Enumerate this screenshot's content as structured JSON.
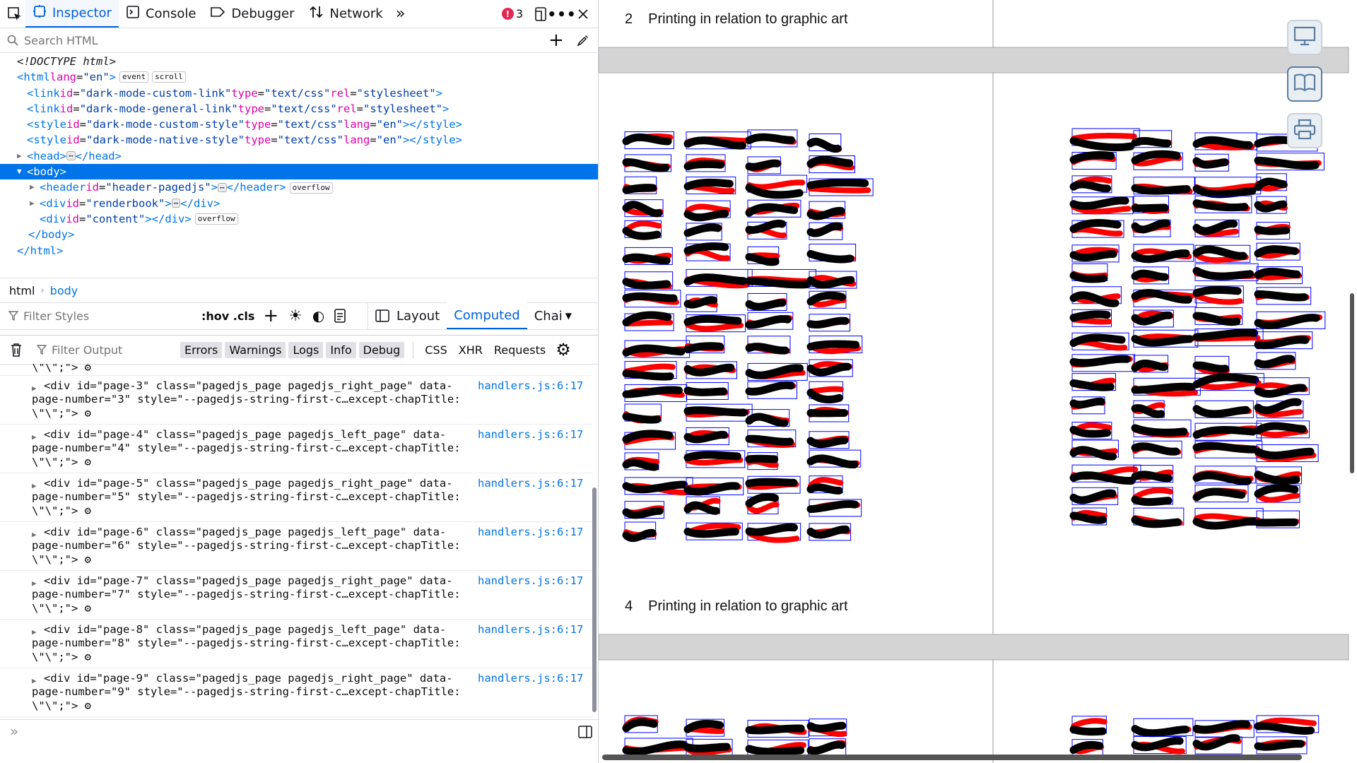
{
  "devtools": {
    "toolbar": {
      "tabs": [
        {
          "label": "Inspector",
          "icon": "inspector-icon"
        },
        {
          "label": "Console",
          "icon": "console-icon"
        },
        {
          "label": "Debugger",
          "icon": "debugger-icon"
        },
        {
          "label": "Network",
          "icon": "network-icon"
        }
      ],
      "error_count": "3"
    },
    "search_html": {
      "placeholder": "Search HTML"
    },
    "markup": {
      "doctype": "<!DOCTYPE html>",
      "html_open": "<html",
      "html_lang_attr": "lang",
      "html_lang_val": "\"en\"",
      "badge_event": "event",
      "badge_scroll": "scroll",
      "links": [
        {
          "tag": "<link",
          "id": "\"dark-mode-custom-link\"",
          "a2": "type",
          "v2": "\"text/css\"",
          "a3": "rel",
          "v3": "\"stylesheet\"",
          "close": ">"
        },
        {
          "tag": "<link",
          "id": "\"dark-mode-general-link\"",
          "a2": "type",
          "v2": "\"text/css\"",
          "a3": "rel",
          "v3": "\"stylesheet\"",
          "close": ">"
        },
        {
          "tag": "<style",
          "id": "\"dark-mode-custom-style\"",
          "a2": "type",
          "v2": "\"text/css\"",
          "a3": "lang",
          "v3": "\"en\"",
          "close": "></style>"
        },
        {
          "tag": "<style",
          "id": "\"dark-mode-native-style\"",
          "a2": "type",
          "v2": "\"text/css\"",
          "a3": "lang",
          "v3": "\"en\"",
          "close": "></style>"
        }
      ],
      "head": "<head>",
      "head_close": "</head>",
      "body": "<body>",
      "header_tag": "<header",
      "header_id": "\"header-pagedjs\"",
      "header_close": "</header>",
      "badge_overflow": "overflow",
      "div_tag": "<div",
      "renderbook_id": "\"renderbook\"",
      "div_close": "</div>",
      "content_id": "\"content\"",
      "content_close": "></div>",
      "body_close": "</body>",
      "html_close": "</html>",
      "id_attr": "id"
    },
    "breadcrumbs": [
      "html",
      "body"
    ],
    "rules": {
      "filter_placeholder": "Filter Styles",
      "pseudo": ":hov .cls",
      "tabs": [
        "Layout",
        "Computed",
        "Chai"
      ]
    },
    "console": {
      "filter_placeholder": "Filter Output",
      "levels": [
        "Errors",
        "Warnings",
        "Logs",
        "Info",
        "Debug"
      ],
      "types": [
        "CSS",
        "XHR",
        "Requests"
      ],
      "first_partial": "\\\"\\\";\">",
      "entries": [
        {
          "l1": "<div id=\"page-3\" class=\"pagedjs_page pagedjs_right_page\" data-",
          "l2": "page-number=\"3\" style=\"--pagedjs-string-first-c…except-chapTitle:",
          "l3": "\\\"\\\";\">",
          "src": "handlers.js:6:17"
        },
        {
          "l1": "<div id=\"page-4\" class=\"pagedjs_page pagedjs_left_page\" data-",
          "l2": "page-number=\"4\" style=\"--pagedjs-string-first-c…except-chapTitle:",
          "l3": "\\\"\\\";\">",
          "src": "handlers.js:6:17"
        },
        {
          "l1": "<div id=\"page-5\" class=\"pagedjs_page pagedjs_right_page\" data-",
          "l2": "page-number=\"5\" style=\"--pagedjs-string-first-c…except-chapTitle:",
          "l3": "\\\"\\\";\">",
          "src": "handlers.js:6:17"
        },
        {
          "l1": "<div id=\"page-6\" class=\"pagedjs_page pagedjs_left_page\" data-",
          "l2": "page-number=\"6\" style=\"--pagedjs-string-first-c…except-chapTitle:",
          "l3": "\\\"\\\";\">",
          "src": "handlers.js:6:17"
        },
        {
          "l1": "<div id=\"page-7\" class=\"pagedjs_page pagedjs_right_page\" data-",
          "l2": "page-number=\"7\" style=\"--pagedjs-string-first-c…except-chapTitle:",
          "l3": "\\\"\\\";\">",
          "src": "handlers.js:6:17"
        },
        {
          "l1": "<div id=\"page-8\" class=\"pagedjs_page pagedjs_left_page\" data-",
          "l2": "page-number=\"8\" style=\"--pagedjs-string-first-c…except-chapTitle:",
          "l3": "\\\"\\\";\">",
          "src": "handlers.js:6:17"
        },
        {
          "l1": "<div id=\"page-9\" class=\"pagedjs_page pagedjs_right_page\" data-",
          "l2": "page-number=\"9\" style=\"--pagedjs-string-first-c…except-chapTitle:",
          "l3": "\\\"\\\";\">",
          "src": "handlers.js:6:17"
        }
      ]
    }
  },
  "viewer": {
    "page2_number": "2",
    "page2_title": "Printing in relation to graphic art",
    "page4_number": "4",
    "page4_title": "Printing in relation to graphic art",
    "side_buttons": [
      "monitor-icon",
      "book-icon",
      "printer-icon"
    ],
    "colors": {
      "stroke_red": "#ff0000",
      "stroke_black": "#000000",
      "box_blue": "#0000ff",
      "gap_gray": "#d4d4d4"
    }
  }
}
